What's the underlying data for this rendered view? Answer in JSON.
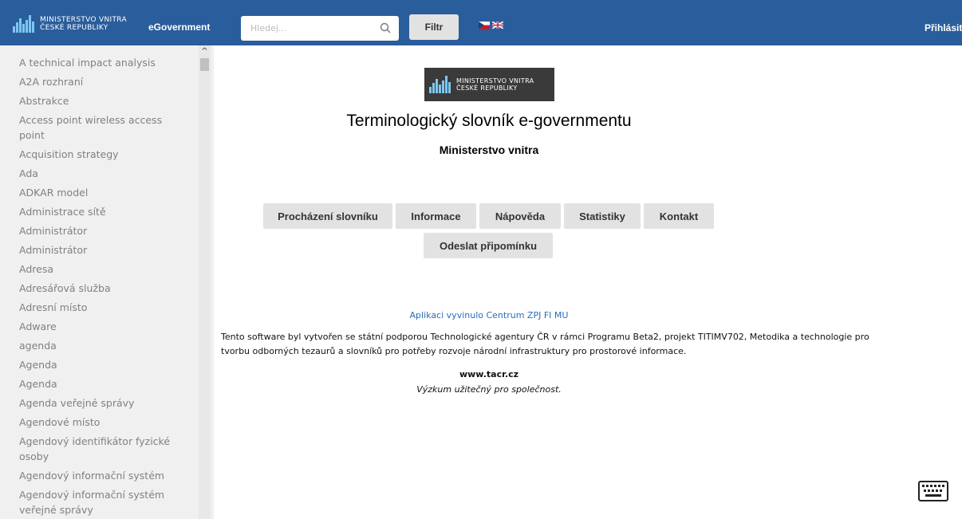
{
  "header": {
    "logo_line1": "MINISTERSTVO VNITRA",
    "logo_line2": "ČESKÉ REPUBLIKY",
    "brand": "eGovernment",
    "search_placeholder": "Hledej...",
    "filter_label": "Filtr",
    "login_label": "Přihlásit"
  },
  "sidebar": {
    "items": [
      "A technical impact analysis",
      "A2A rozhraní",
      "Abstrakce",
      "Access point wireless access point",
      "Acquisition strategy",
      "Ada",
      "ADKAR model",
      "Administrace sítě",
      "Administrátor",
      "Administrátor",
      "Adresa",
      "Adresářová služba",
      "Adresní místo",
      "Adware",
      "agenda",
      "Agenda",
      "Agenda",
      "Agenda veřejné správy",
      "Agendové místo",
      "Agendový identifikátor fyzické osoby",
      "Agendový informační systém",
      "Agendový informační systém veřejné správy"
    ]
  },
  "main": {
    "logo_line1": "MINISTERSTVO VNITRA",
    "logo_line2": "ČESKÉ REPUBLIKY",
    "title": "Terminologický slovník e-governmentu",
    "subtitle": "Ministerstvo vnitra",
    "nav": {
      "browse": "Procházení slovníku",
      "info": "Informace",
      "help": "Nápověda",
      "stats": "Statistiky",
      "contact": "Kontakt",
      "feedback": "Odeslat připomínku"
    },
    "credit": "Aplikaci vyvinulo Centrum ZPJ FI MU",
    "note": "Tento software byl vytvořen se státní podporou Technologické agentury ČR v rámci Programu Beta2, projekt TITIMV702, Metodika a technologie pro tvorbu odborných tezaurů a slovníků pro potřeby rozvoje národní infrastruktury pro prostorové informace.",
    "tacr": "www.tacr.cz",
    "motto": "Výzkum užitečný pro společnost."
  },
  "colors": {
    "header_bg": "#2a5d9c",
    "sidebar_bg": "#f0f0f0",
    "button_bg": "#e2e2e2",
    "link": "#2a6cb8"
  },
  "icons": [
    "search-icon",
    "czech-flag-icon",
    "uk-flag-icon",
    "keyboard-icon"
  ]
}
